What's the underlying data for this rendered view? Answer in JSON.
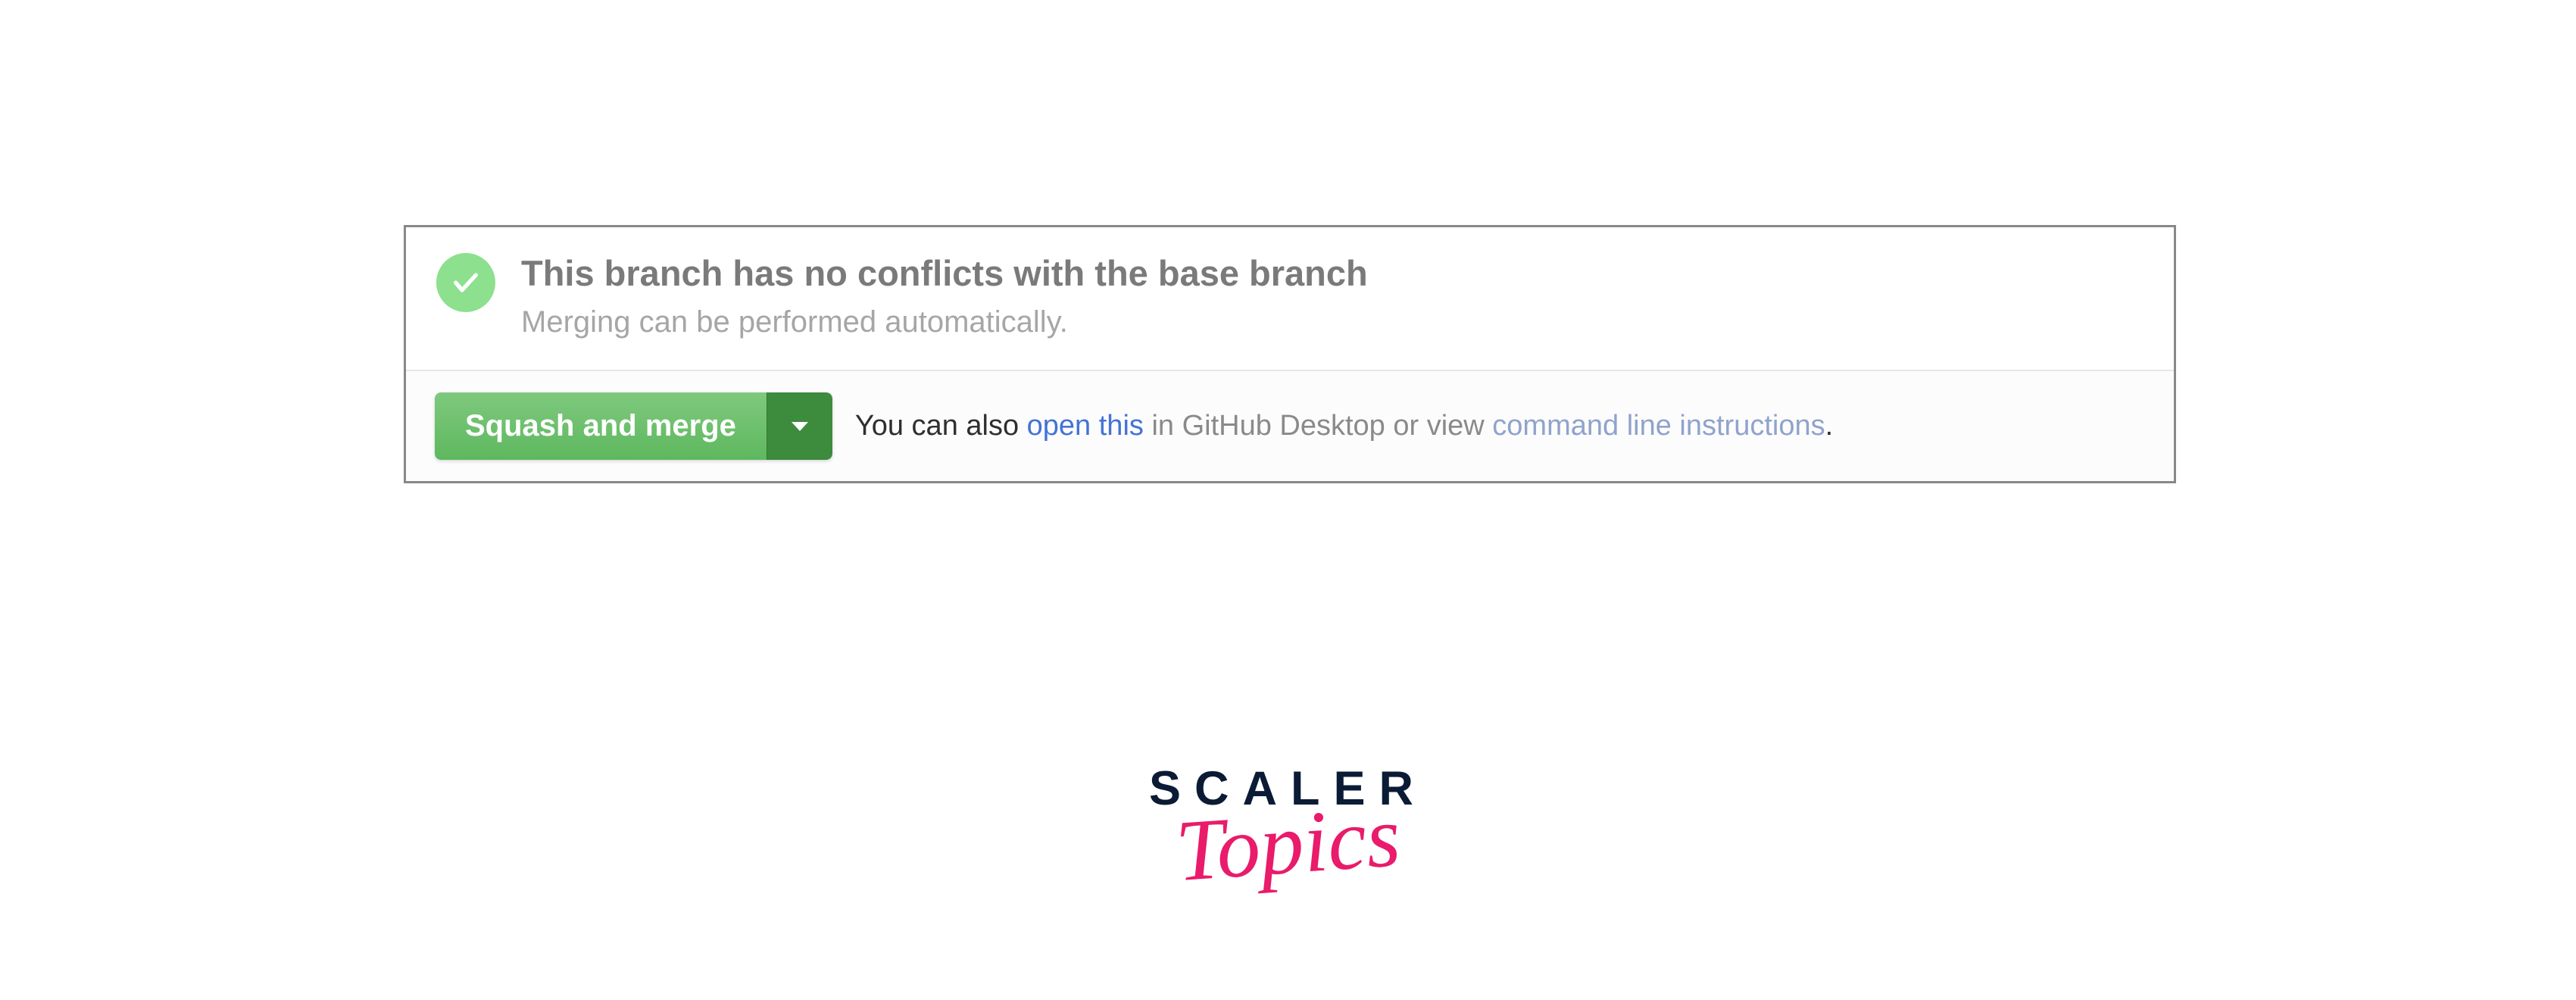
{
  "status": {
    "title": "This branch has no conflicts with the base branch",
    "subtitle": "Merging can be performed automatically."
  },
  "actions": {
    "merge_label": "Squash and merge",
    "hint_prefix": "You can also ",
    "hint_link_open": "open this",
    "hint_mid1": " in GitHub Desktop",
    "hint_mid2": " or view ",
    "hint_link_cli": "command line instructions",
    "hint_suffix": "."
  },
  "logo": {
    "line1": "SCALER",
    "line2": "Topics"
  },
  "colors": {
    "check_bg": "#8de08d",
    "button_green_top": "#7ec97e",
    "button_green_bottom": "#5eb85e",
    "dropdown_green": "#3d8b3d",
    "link_blue": "#4373d6",
    "logo_dark": "#0b1b35",
    "logo_pink": "#e91b6a"
  }
}
